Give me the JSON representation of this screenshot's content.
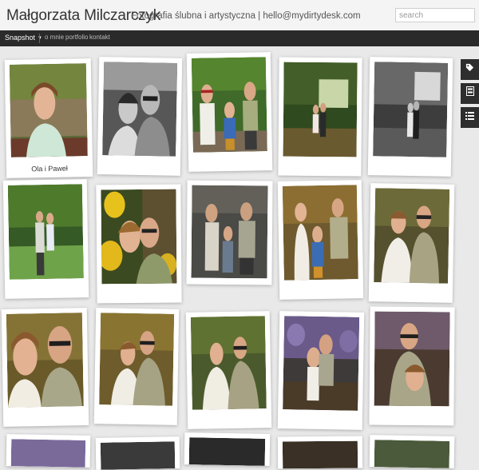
{
  "header": {
    "title": "Małgorzata Milczarczyk",
    "description": "Fotografia ślubna i artystyczna | hello@mydirtydesk.com",
    "search_placeholder": "search"
  },
  "navbar": {
    "view_label": "Snapshot",
    "links": [
      "o mnie",
      "portfolio",
      "kontakt"
    ]
  },
  "posts": [
    {
      "caption": "Ola i Paweł",
      "tone": "color"
    },
    {
      "caption": "",
      "tone": "bw"
    },
    {
      "caption": "",
      "tone": "color"
    },
    {
      "caption": "",
      "tone": "color"
    },
    {
      "caption": "",
      "tone": "bw"
    },
    {
      "caption": "",
      "tone": "color"
    },
    {
      "caption": "",
      "tone": "color"
    },
    {
      "caption": "",
      "tone": "color"
    },
    {
      "caption": "",
      "tone": "color"
    },
    {
      "caption": "",
      "tone": "color"
    },
    {
      "caption": "",
      "tone": "color"
    },
    {
      "caption": "",
      "tone": "color"
    },
    {
      "caption": "",
      "tone": "color"
    },
    {
      "caption": "",
      "tone": "color"
    },
    {
      "caption": "",
      "tone": "color"
    }
  ],
  "sidebar_icons": [
    "tag-icon",
    "archive-icon",
    "list-icon"
  ],
  "colors": {
    "header_bg": "#f4f4f4",
    "navbar_bg": "#2a2a2a",
    "page_bg": "#e9e9e9",
    "sidebar_bg": "#2e2e2e"
  }
}
